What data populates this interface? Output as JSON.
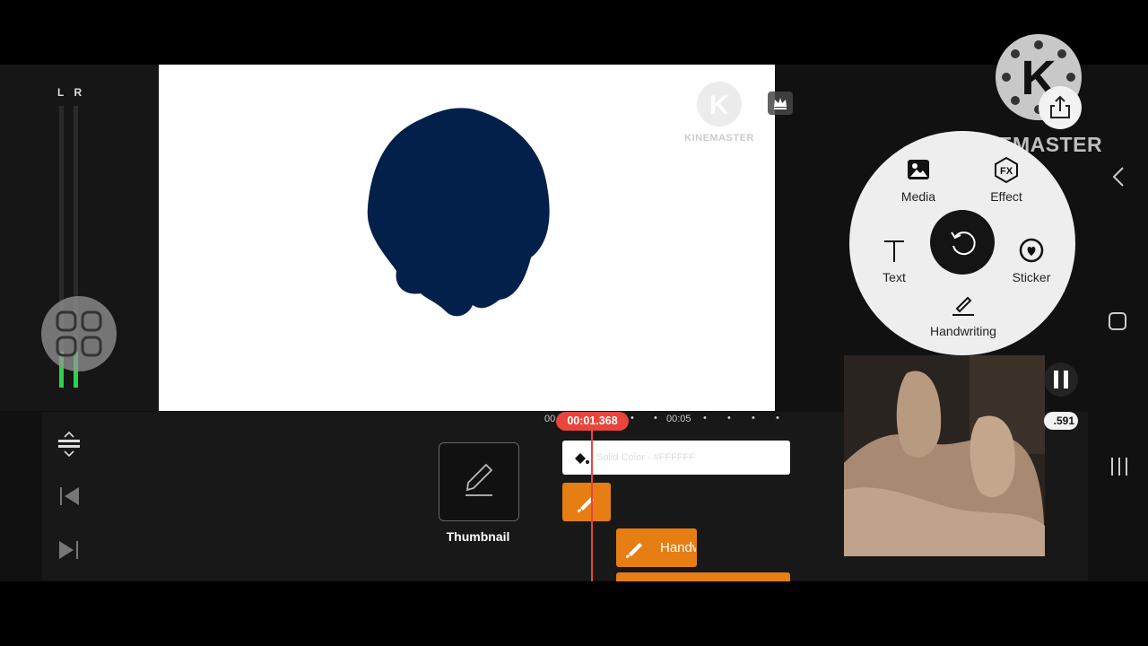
{
  "meter": {
    "channels_label": "L R",
    "left_level": 0.12,
    "right_level": 0.12
  },
  "preview": {
    "watermark_text": "KINEMASTER",
    "shape_color": "#03204a",
    "background": "#ffffff"
  },
  "timeline": {
    "ruler_start": "00",
    "ruler_mark": "00:05",
    "current_time": "00:01.368",
    "background_clip_label": "Solid Color - #FFFFFF",
    "handwriting_clip_label": "Handwriting",
    "accent_color": "#e67e14",
    "playhead_color": "#e8453c"
  },
  "thumbnail": {
    "label": "Thumbnail"
  },
  "brand": {
    "logo_letter": "K",
    "wordmark": "KINEMASTER"
  },
  "media_wheel": {
    "items": [
      {
        "label": "Media",
        "icon": "image-icon"
      },
      {
        "label": "Effect",
        "icon": "fx-icon"
      },
      {
        "label": "Text",
        "icon": "text-icon"
      },
      {
        "label": "Sticker",
        "icon": "sticker-icon"
      },
      {
        "label": "Handwriting",
        "icon": "pen-icon"
      }
    ],
    "center_icon": "undo-rotate-icon"
  },
  "overlay": {
    "time_fragment": ".591"
  },
  "system_nav": [
    "back-icon",
    "home-icon",
    "recent-apps-icon"
  ]
}
